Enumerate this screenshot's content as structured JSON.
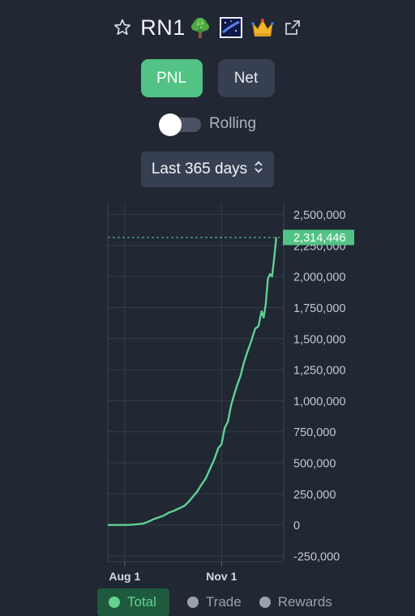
{
  "header": {
    "title": "RN1",
    "icons": [
      "star-outline-icon",
      "tree-emoji-icon",
      "night-sky-badge-icon",
      "crown-emoji-icon",
      "external-link-icon"
    ]
  },
  "mode_buttons": {
    "pnl_label": "PNL",
    "net_label": "Net",
    "selected": "PNL"
  },
  "rolling": {
    "label": "Rolling",
    "enabled": false
  },
  "range_select": {
    "value": "Last 365 days"
  },
  "colors": {
    "background": "#212733",
    "accent": "#52c384",
    "line": "#5fd193",
    "button_inactive": "#374052"
  },
  "chart_data": {
    "type": "line",
    "title": "",
    "xlabel": "",
    "ylabel": "",
    "x_ticks": [
      "Aug 1",
      "Nov 1"
    ],
    "y_ticks": [
      "2,500,000",
      "2,250,000",
      "2,000,000",
      "1,750,000",
      "1,500,000",
      "1,250,000",
      "1,000,000",
      "750,000",
      "500,000",
      "250,000",
      "0",
      "-250,000"
    ],
    "ylim": [
      -250000,
      2500000
    ],
    "xlim": [
      "2025-07-16",
      "2025-12-30"
    ],
    "grid": true,
    "current_value_label": "2,314,446",
    "series": [
      {
        "name": "Total",
        "x": [
          "2025-07-16",
          "2025-07-22",
          "2025-07-28",
          "2025-08-01",
          "2025-08-07",
          "2025-08-13",
          "2025-08-18",
          "2025-08-23",
          "2025-08-28",
          "2025-09-02",
          "2025-09-07",
          "2025-09-12",
          "2025-09-17",
          "2025-09-22",
          "2025-09-27",
          "2025-10-01",
          "2025-10-05",
          "2025-10-09",
          "2025-10-13",
          "2025-10-17",
          "2025-10-21",
          "2025-10-25",
          "2025-10-29",
          "2025-11-01",
          "2025-11-04",
          "2025-11-07",
          "2025-11-10",
          "2025-11-13",
          "2025-11-16",
          "2025-11-19",
          "2025-11-22",
          "2025-11-25",
          "2025-11-28",
          "2025-11-30",
          "2025-12-01",
          "2025-12-03",
          "2025-12-06",
          "2025-12-09",
          "2025-12-11",
          "2025-12-13",
          "2025-12-15",
          "2025-12-17",
          "2025-12-19",
          "2025-12-21",
          "2025-12-23"
        ],
        "y": [
          0,
          0,
          0,
          0,
          2000,
          6000,
          10000,
          25000,
          45000,
          60000,
          75000,
          100000,
          115000,
          135000,
          155000,
          190000,
          230000,
          270000,
          325000,
          375000,
          450000,
          525000,
          620000,
          650000,
          780000,
          830000,
          960000,
          1050000,
          1130000,
          1200000,
          1300000,
          1380000,
          1450000,
          1500000,
          1530000,
          1580000,
          1600000,
          1720000,
          1670000,
          1780000,
          1980000,
          2020000,
          2000000,
          2150000,
          2314446
        ]
      }
    ]
  },
  "legend": {
    "items": [
      {
        "label": "Total",
        "active": true
      },
      {
        "label": "Trade",
        "active": false
      },
      {
        "label": "Rewards",
        "active": false
      }
    ]
  }
}
